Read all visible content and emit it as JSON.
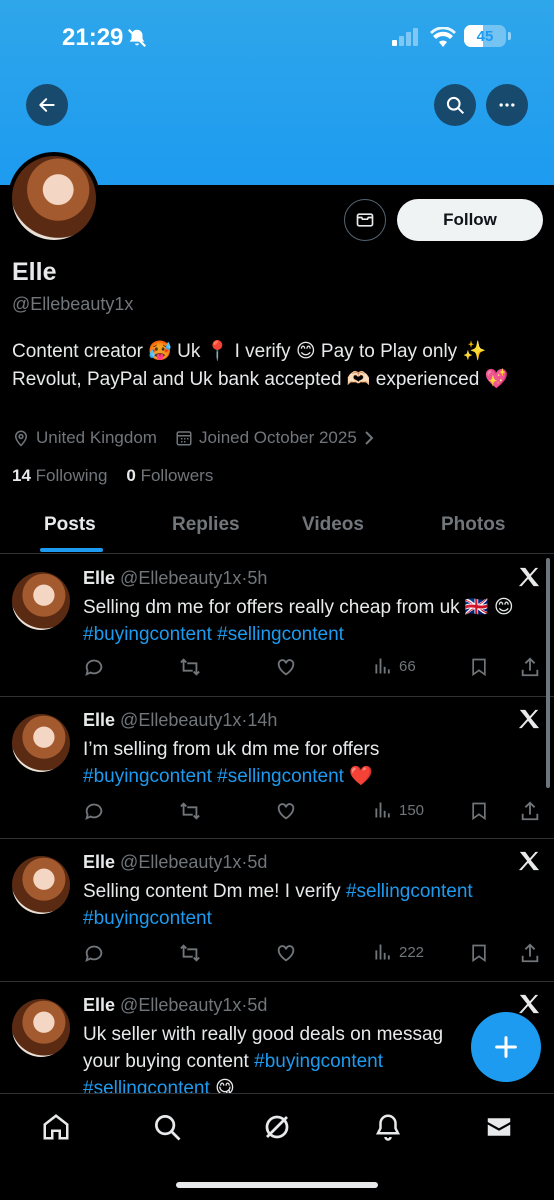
{
  "status_bar": {
    "time": "21:29",
    "battery": "45",
    "battery_fraction": 0.45
  },
  "profile": {
    "name": "Elle",
    "handle": "@Ellebeauty1x",
    "bio": "Content creator 🥵 Uk 📍 I verify 😊 Pay to Play only ✨ Revolut, PayPal and Uk bank accepted 🫶🏻 experienced 💖",
    "location": "United Kingdom",
    "joined": "Joined October 2025",
    "following_count": "14",
    "following_label": "Following",
    "followers_count": "0",
    "followers_label": "Followers",
    "follow_label": "Follow"
  },
  "tabs": [
    {
      "label": "Posts",
      "active": true
    },
    {
      "label": "Replies",
      "active": false
    },
    {
      "label": "Videos",
      "active": false
    },
    {
      "label": "Photos",
      "active": false
    }
  ],
  "posts": [
    {
      "name": "Elle",
      "handle": "@Ellebeauty1x",
      "time": "5h",
      "text_plain": "Selling dm me for offers really cheap from uk 🇬🇧 😊",
      "tag1": "#buyingcontent",
      "tag2": "#sellingcontent",
      "suffix": "",
      "views": "66"
    },
    {
      "name": "Elle",
      "handle": "@Ellebeauty1x",
      "time": "14h",
      "text_plain": "I’m selling from uk dm me for offers",
      "tag1": "#buyingcontent",
      "tag2": "#sellingcontent",
      "suffix": "❤️",
      "views": "150"
    },
    {
      "name": "Elle",
      "handle": "@Ellebeauty1x",
      "time": "5d",
      "text_plain": "Selling content Dm me! I verify",
      "tag1": "#sellingcontent",
      "tag2": "#buyingcontent",
      "suffix": "",
      "views": "222"
    },
    {
      "name": "Elle",
      "handle": "@Ellebeauty1x",
      "time": "5d",
      "text_plain": "Uk seller with really good  deals on messag your buying content",
      "tag1": "#buyingcontent",
      "tag2": "#sellingcontent",
      "suffix": "😋",
      "views": ""
    }
  ],
  "colors": {
    "accent": "#1d9bf0",
    "muted": "#71767b",
    "text": "#e7e9ea",
    "background": "#000000"
  },
  "icons": [
    "back-arrow-icon",
    "search-icon",
    "more-icon",
    "mail-icon",
    "location-icon",
    "calendar-icon",
    "x-logo-icon",
    "reply-icon",
    "repost-icon",
    "like-icon",
    "views-icon",
    "bookmark-icon",
    "share-icon",
    "plus-icon",
    "home-icon",
    "grok-icon",
    "bell-icon",
    "messages-icon"
  ]
}
